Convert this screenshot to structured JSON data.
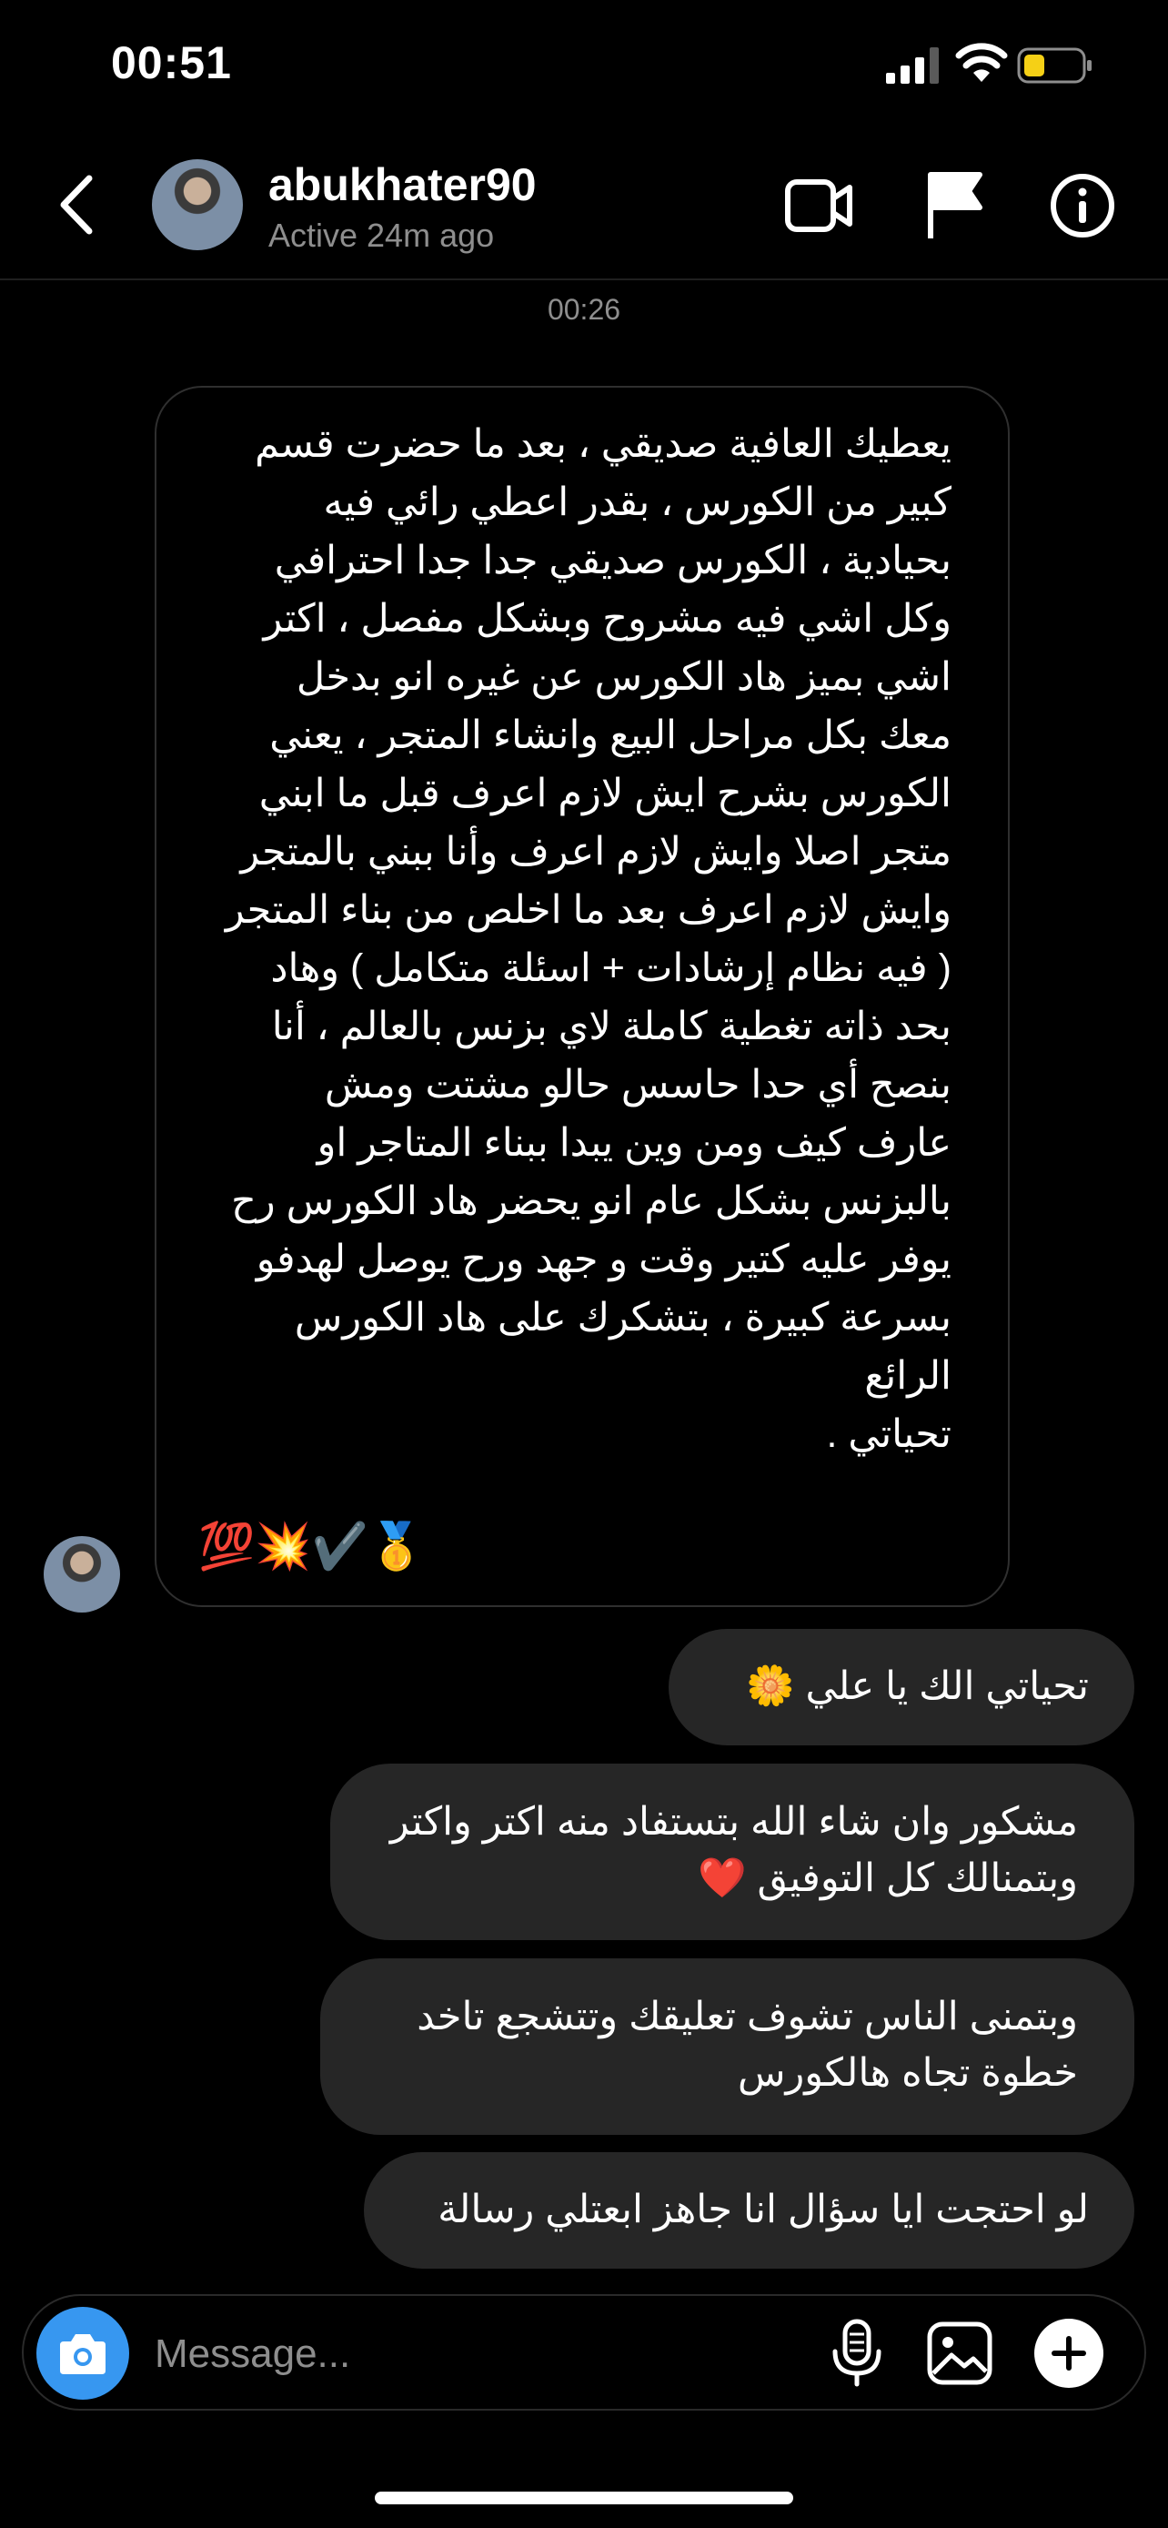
{
  "status_bar": {
    "time": "00:51"
  },
  "header": {
    "username": "abukhater90",
    "active_status": "Active 24m ago"
  },
  "thread": {
    "timestamp": "00:26",
    "incoming_message": "يعطيك العافية صديقي ، بعد ما حضرت قسم\nكبير من الكورس ، بقدر اعطي رائي فيه\nبحيادية ، الكورس صديقي جدا جدا احترافي\nوكل اشي فيه مشروح وبشكل مفصل ، اكتر\nاشي بميز هاد الكورس عن غيره انو بدخل\nمعك بكل مراحل البيع وانشاء المتجر ، يعني\nالكورس بشرح ايش لازم اعرف قبل ما ابني\nمتجر اصلا وايش لازم اعرف وأنا ببني بالمتجر\nوايش لازم اعرف بعد ما اخلص من بناء المتجر\n( فيه نظام إرشادات + اسئلة متكامل ) وهاد\nبحد ذاته تغطية كاملة لاي بزنس بالعالم ، أنا\nبنصح أي حدا حاسس حالو مشتت ومش\nعارف كيف ومن وين يبدا ببناء المتاجر او\nبالبزنس بشكل عام انو يحضر هاد الكورس رح\nيوفر عليه كتير وقت و جهد ورح يوصل لهدفو\nبسرعة كبيرة ، بتشكرك على هاد الكورس\nالرائع\nتحياتي .",
    "incoming_emojis": "💯💥✔️🥇",
    "outgoing_messages": [
      "تحياتي الك يا علي 🌼",
      "مشكور وان شاء الله بتستفاد منه اكتر واكتر\nوبتمنالك كل التوفيق ❤️",
      "وبتمنى الناس تشوف تعليقك وتتشجع تاخد\nخطوة تجاه هالكورس",
      "لو احتجت ايا سؤال انا جاهز ابعتلي رسالة"
    ]
  },
  "composer": {
    "placeholder": "Message..."
  },
  "colors": {
    "background": "#000000",
    "bubble_out": "#262626",
    "accent": "#3797f0",
    "battery_low": "#f5d016"
  },
  "icons": [
    "signal-icon",
    "wifi-icon",
    "battery-icon",
    "back-chevron-icon",
    "video-call-icon",
    "flag-icon",
    "info-icon",
    "camera-icon",
    "microphone-icon",
    "gallery-icon",
    "plus-icon"
  ]
}
